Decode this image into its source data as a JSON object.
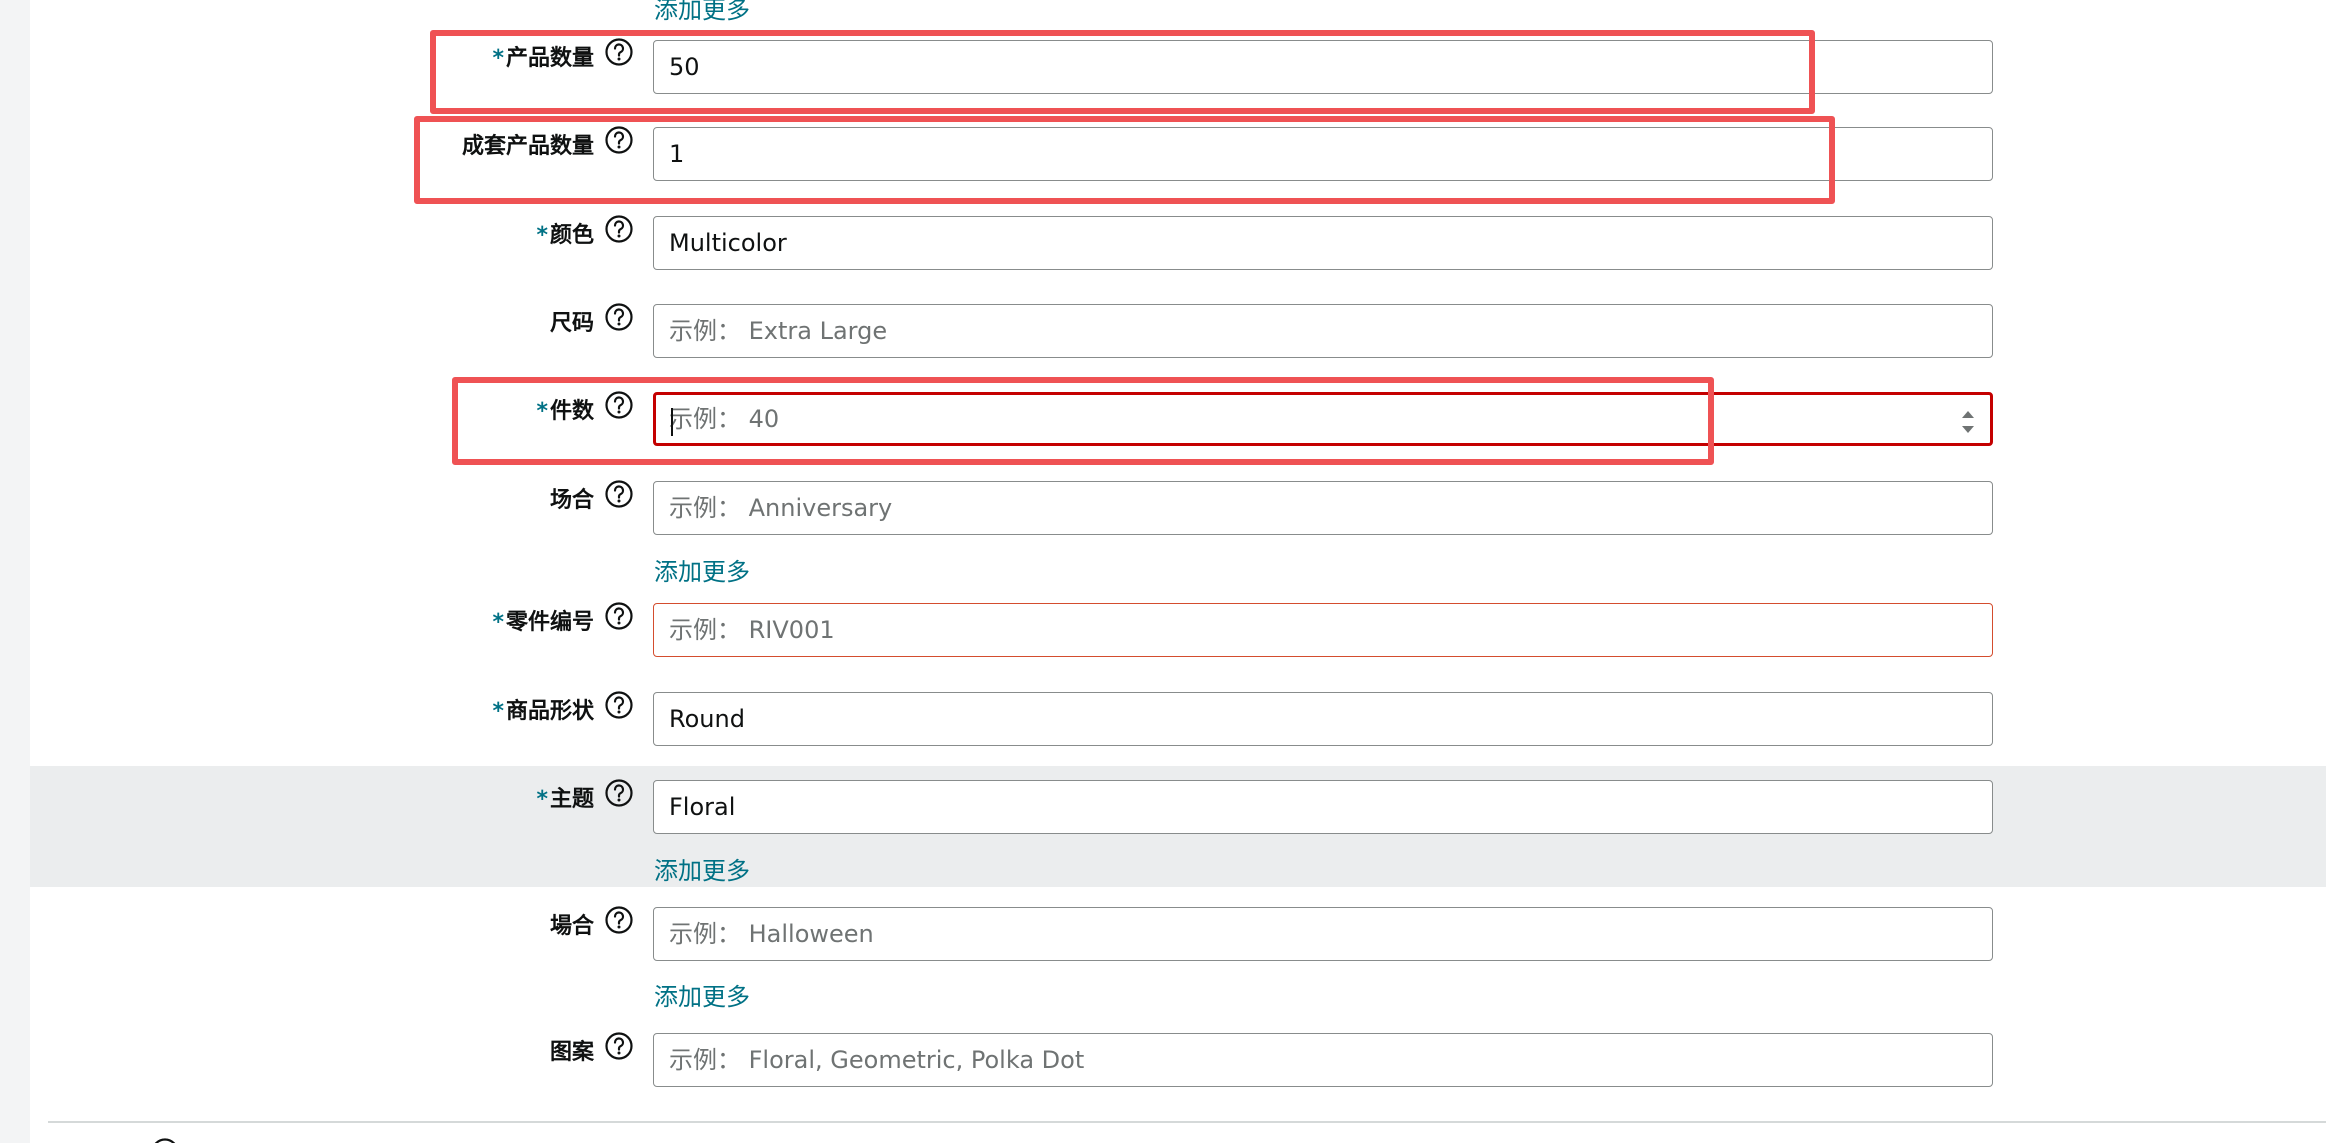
{
  "add_more_label": "添加更多",
  "example_prefix": "示例：",
  "fields": {
    "product_quantity": {
      "label": "产品数量",
      "required": "*",
      "value": "50"
    },
    "set_quantity": {
      "label": "成套产品数量",
      "required": "",
      "value": "1"
    },
    "color": {
      "label": "颜色",
      "required": "*",
      "value": "Multicolor"
    },
    "size": {
      "label": "尺码",
      "required": "",
      "placeholder": "示例： Extra Large"
    },
    "piece_count": {
      "label": "件数",
      "required": "*",
      "placeholder": "示例： 40"
    },
    "occasion": {
      "label": "场合",
      "required": "",
      "placeholder": "示例： Anniversary"
    },
    "part_number": {
      "label": "零件编号",
      "required": "*",
      "placeholder": "示例： RIV001"
    },
    "item_shape": {
      "label": "商品形状",
      "required": "*",
      "value": "Round"
    },
    "theme": {
      "label": "主题",
      "required": "*",
      "value": "Floral"
    },
    "occasion_type": {
      "label": "場合",
      "required": "",
      "placeholder": "示例： Halloween"
    },
    "pattern": {
      "label": "图案",
      "required": "",
      "placeholder": "示例： Floral, Geometric, Polka Dot"
    }
  },
  "colors": {
    "accent_teal": "#007185",
    "error_red": "#c40000",
    "annotation_red": "#ef5254",
    "highlight_row": "#ebedee"
  },
  "icons": {
    "help": "help-circle-icon",
    "spinner": "spinner-arrows-icon"
  }
}
